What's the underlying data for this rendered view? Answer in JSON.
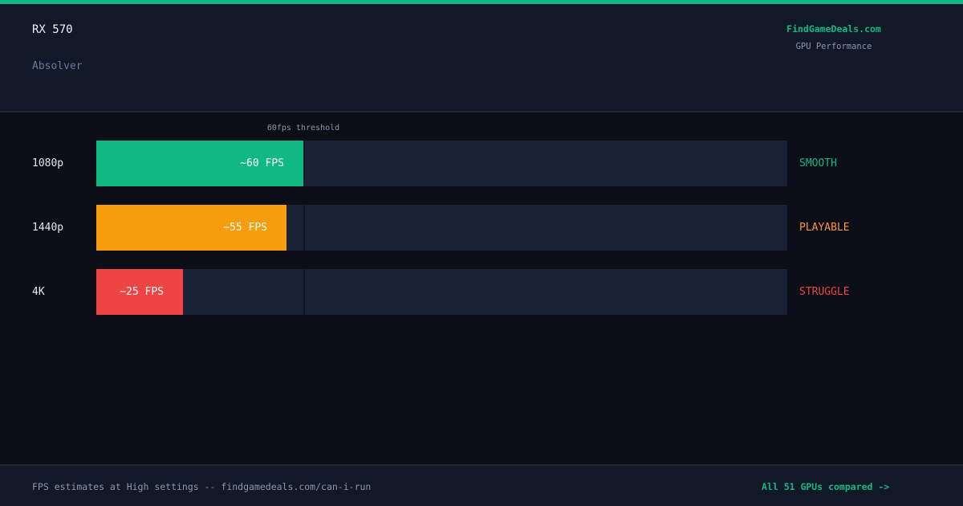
{
  "header": {
    "gpu": "RX 570",
    "game": "Absolver",
    "brand": "FindGameDeals.com",
    "brand_sub": "GPU Performance"
  },
  "chart_data": {
    "type": "bar",
    "orientation": "horizontal",
    "categories": [
      "1080p",
      "1440p",
      "4K"
    ],
    "values": [
      60,
      55,
      25
    ],
    "value_labels": [
      "~60 FPS",
      "~55 FPS",
      "~25 FPS"
    ],
    "status": [
      "SMOOTH",
      "PLAYABLE",
      "STRUGGLE"
    ],
    "colors": [
      "#10b981",
      "#f59e0b",
      "#ef4444"
    ],
    "status_colors": [
      "#10b981",
      "#fb923c",
      "#ef4444"
    ],
    "threshold": {
      "value": 60,
      "label": "60fps threshold"
    },
    "xlim": [
      0,
      200
    ]
  },
  "footer": {
    "note": "FPS estimates at High settings -- findgamedeals.com/can-i-run",
    "link": "All 51 GPUs compared ->"
  }
}
